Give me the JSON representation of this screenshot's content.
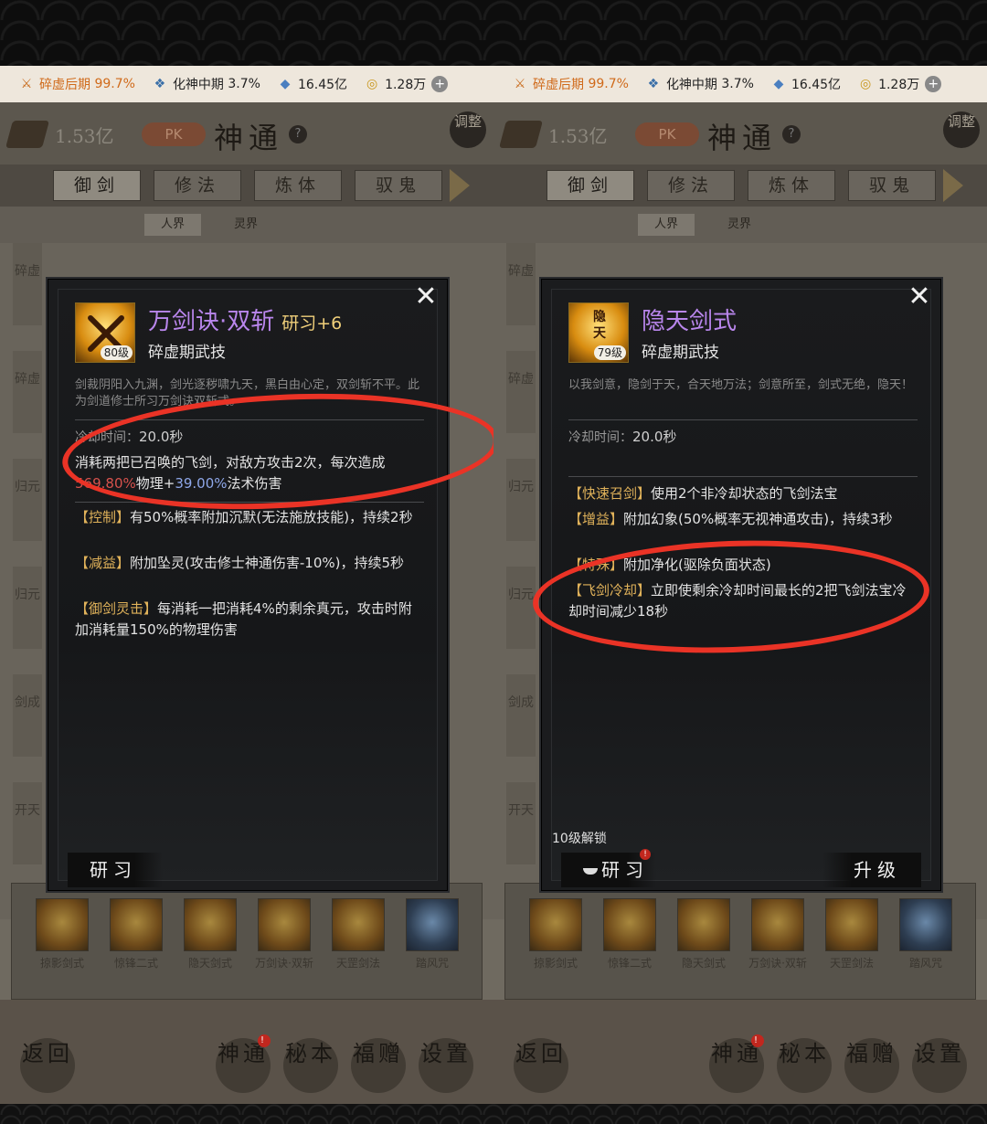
{
  "status": {
    "realm1": "碎虚后期",
    "realm1_pct": "99.7%",
    "realm2": "化神中期",
    "realm2_pct": "3.7%",
    "stones": "16.45亿",
    "coins": "1.28万"
  },
  "header": {
    "money": "1.53亿",
    "pk": "PK",
    "title": "神通",
    "adjust": "调整"
  },
  "tabs": [
    "御剑",
    "修法",
    "炼体",
    "驭鬼"
  ],
  "subtabs": [
    "人界",
    "灵界"
  ],
  "realms": [
    "碎虚",
    "碎虚",
    "归元",
    "归元",
    "剑成",
    "开天"
  ],
  "skills": [
    "掠影剑式",
    "惊锋二式",
    "隐天剑式",
    "万剑诀·双斩",
    "天罡剑法",
    "踏风咒"
  ],
  "nav": [
    "返回",
    "神通",
    "秘本",
    "福赠",
    "设置"
  ],
  "left_modal": {
    "name": "万剑诀·双斩",
    "research": "研习+6",
    "level": "80级",
    "type": "碎虚期武技",
    "desc": "剑裁阴阳入九渊，剑光逐秽啸九天，黑白由心定，双剑斩不平。此为剑道修士所习万剑诀双斩式。",
    "cd_label": "冷却时间：",
    "cd_value": "20.0秒",
    "main_effect_a": "消耗两把已召唤的飞剑，对敌方攻击2次，每次造成",
    "main_effect_phys": "569.80%",
    "main_effect_phys_label": "物理+",
    "main_effect_mag": "39.00%",
    "main_effect_mag_label": "法术伤害",
    "effects": [
      {
        "tag": "【控制】",
        "text": "有50%概率附加沉默(无法施放技能)，持续2秒"
      },
      {
        "tag": "【减益】",
        "text": "附加坠灵(攻击修士神通伤害-10%)，持续5秒"
      },
      {
        "tag": "【御剑灵击】",
        "text": "每消耗一把消耗4%的剩余真元，攻击时附加消耗量150%的物理伤害"
      }
    ],
    "button": "研习"
  },
  "right_modal": {
    "name": "隐天剑式",
    "level": "79级",
    "seal": "隐天",
    "type": "碎虚期武技",
    "desc": "以我剑意，隐剑于天，合天地万法；剑意所至，剑式无绝，隐天！",
    "cd_label": "冷却时间：",
    "cd_value": "20.0秒",
    "effects": [
      {
        "tag": "【快速召剑】",
        "text": "使用2个非冷却状态的飞剑法宝"
      },
      {
        "tag": "【增益】",
        "text": "附加幻象(50%概率无视神通攻击)，持续3秒"
      },
      {
        "tag": "【特殊】",
        "text": "附加净化(驱除负面状态)"
      },
      {
        "tag": "【飞剑冷却】",
        "text": "立即使剩余冷却时间最长的2把飞剑法宝冷却时间减少18秒"
      }
    ],
    "unlock": "10级解锁",
    "button_study": "研习",
    "button_upgrade": "升级"
  },
  "colors": {
    "annotation": "#ea3326",
    "skill_name": "#b986ec",
    "tag": "#e0b25a"
  }
}
